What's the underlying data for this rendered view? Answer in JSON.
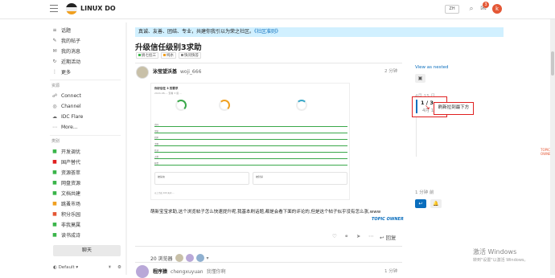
{
  "header": {
    "site_name": "LINUX DO",
    "lang_label": "ZH",
    "notification_count": "3",
    "avatar_letter": "k"
  },
  "sidebar": {
    "items": [
      {
        "icon": "topics-icon",
        "glyph": "≡",
        "label": "话题"
      },
      {
        "icon": "my-posts-icon",
        "glyph": "✎",
        "label": "我的帖子"
      },
      {
        "icon": "messages-icon",
        "glyph": "✉",
        "label": "我的消息"
      },
      {
        "icon": "activity-icon",
        "glyph": "↻",
        "label": "近期活动"
      },
      {
        "icon": "more-icon",
        "glyph": "⋮",
        "label": "更多"
      }
    ],
    "section_links": "资源",
    "links": [
      {
        "icon": "connect-icon",
        "glyph": "☍",
        "label": "Connect"
      },
      {
        "icon": "channel-icon",
        "glyph": "◎",
        "label": "Channel"
      },
      {
        "icon": "cloudflare-icon",
        "glyph": "☁",
        "label": "IDC Flare"
      },
      {
        "icon": "more-icon",
        "glyph": "⋯",
        "label": "More..."
      }
    ],
    "section_categories": "类别",
    "categories": [
      {
        "label": "开发调优",
        "color": "#3ab54a"
      },
      {
        "label": "国产替代",
        "color": "#e02020"
      },
      {
        "label": "资源荟萃",
        "color": "#3ab54a"
      },
      {
        "label": "网盘资源",
        "color": "#3ab54a"
      },
      {
        "label": "文档共建",
        "color": "#3ab54a"
      },
      {
        "label": "跳蚤市场",
        "color": "#f0a020"
      },
      {
        "label": "积分乐园",
        "color": "#e45735"
      },
      {
        "label": "非我莫属",
        "color": "#3ab54a"
      },
      {
        "label": "读书成诗",
        "color": "#3ab54a"
      }
    ],
    "chat_label": "聊天",
    "theme_label": "Default"
  },
  "announcement": {
    "text": "真诚、友善、团结、专业，共建你我引以为荣之社区。",
    "rules_link": "《社区准则》"
  },
  "topic": {
    "title": "升级信任级别3求助",
    "tags": [
      {
        "label": "搞七捻三",
        "color": "#3ab54a"
      },
      {
        "label": "纯水",
        "color": "#f0a020"
      },
      {
        "label": "快问快答",
        "color": "#888888"
      }
    ]
  },
  "post": {
    "author_name": "泳莹望沃基",
    "author_user": "woji_666",
    "time": "2 分钟",
    "screenshot": {
      "title": "你好信任 3 的要求",
      "subtitle": "2024-08-... 查看 3 级 ...",
      "rows": [
        "访问",
        "浏览",
        "回复",
        "主题",
        "已读",
        "点赞",
        "获赞"
      ],
      "boxes": [
        "被禁言",
        "被封禁"
      ],
      "note": "以上为近 100 天内 ..."
    },
    "body": "萌新宝宝求助,这个浏览帖子怎么快速提升呢,我基本刷话题,都是会看下面的评论的,但是这个帖子似乎没有怎么涨,www",
    "topic_owner": "TOPIC OWNER",
    "reply_label": "回复",
    "replies_label": "20 浏览器"
  },
  "reply2": {
    "author_name": "程序猿",
    "author_user": "chengxuyuan",
    "note": "我懂你啊",
    "time": "1 分钟"
  },
  "timeline": {
    "view_nested": "View as nested",
    "start_date": "4月 15 日",
    "position": "1 / 3",
    "position_date": "4月 15 日",
    "callout": "刷新拉到最下方",
    "end_label": "1 分钟 前"
  },
  "windows": {
    "activate": "激活 Windows",
    "activate_sub": "转到\"设置\"以激活 Windows。"
  }
}
